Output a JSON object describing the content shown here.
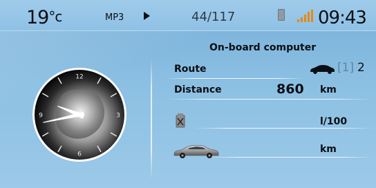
{
  "status_bar": {
    "temperature": "19",
    "temperature_unit": "°c",
    "source": "MP3",
    "play_icon": "play-icon",
    "track": "44/117",
    "phone_icon": "phone-icon",
    "signal_icon": "signal-strength-icon",
    "signal_color": "#e28a18",
    "time": "09:43"
  },
  "trip_computer": {
    "title": "On-board computer",
    "route_label": "Route",
    "route_selector_1": "[1]",
    "route_selector_2": "2",
    "distance_label": "Distance",
    "distance_value": "860",
    "distance_unit": "km",
    "consumption_unit": "l/100",
    "range_unit": "km",
    "route_icon": "car-icon",
    "fuel_icon": "fuel-pump-icon",
    "range_icon": "car-icon"
  },
  "analog_clock": {
    "numerals": [
      "12",
      "3",
      "6",
      "9"
    ],
    "hour": 9,
    "minute": 43
  },
  "colors": {
    "background": "#8cc0e3",
    "text": "#0b0f14",
    "inactive_selector": "#5f86a4"
  }
}
